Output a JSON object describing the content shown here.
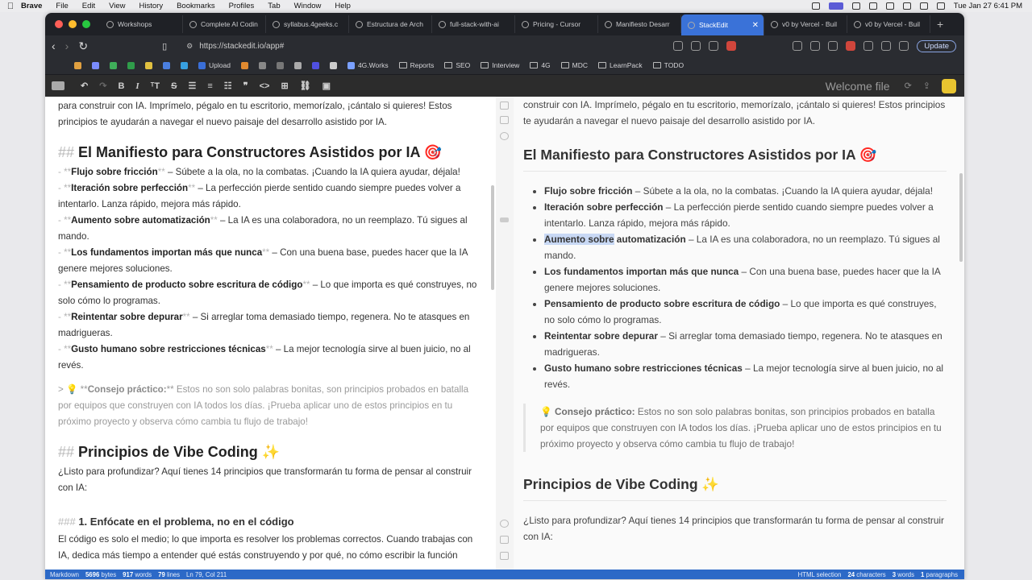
{
  "menubar": {
    "items": [
      "Brave",
      "File",
      "Edit",
      "View",
      "History",
      "Bookmarks",
      "Profiles",
      "Tab",
      "Window",
      "Help"
    ],
    "clock": "Tue Jan 27  6:41 PM"
  },
  "tabs": [
    {
      "label": "Workshops"
    },
    {
      "label": "Complete AI Codin"
    },
    {
      "label": "syllabus.4geeks.c"
    },
    {
      "label": "Estructura de Arch"
    },
    {
      "label": "full-stack-with-ai"
    },
    {
      "label": "Pricing - Cursor"
    },
    {
      "label": "Manifiesto Desarr"
    },
    {
      "label": "StackEdit",
      "active": true
    },
    {
      "label": "v0 by Vercel - Buil"
    },
    {
      "label": "v0 by Vercel - Buil"
    }
  ],
  "address": {
    "url": "https://stackedit.io/app#",
    "update_label": "Update"
  },
  "bookmarks": [
    "Upload",
    "4G.Works",
    "Reports",
    "SEO",
    "Interview",
    "4G",
    "MDC",
    "LearnPack",
    "TODO"
  ],
  "editor_toolbar": {
    "title": "Welcome file"
  },
  "editor": {
    "intro1": "para construir con IA. Imprímelo, pégalo en tu escritorio, memorízalo, ¡cántalo si quieres! Estos principios te ayudarán a navegar el nuevo paisaje del desarrollo asistido por IA.",
    "h2_mark": "##",
    "h2_1": "El Manifiesto para Constructores Asistidos por IA 🎯",
    "bullets": [
      {
        "bold": "Flujo sobre fricción",
        "text": " – Súbete a la ola, no la combatas. ¡Cuando la IA quiera ayudar, déjala!"
      },
      {
        "bold": "Iteración sobre perfección",
        "text": " – La perfección pierde sentido cuando siempre puedes volver a intentarlo. Lanza rápido, mejora más rápido."
      },
      {
        "bold": "Aumento sobre automatización",
        "text": " – La IA es una colaboradora, no un reemplazo. Tú sigues al mando."
      },
      {
        "bold": "Los fundamentos importan más que nunca",
        "text": " – Con una buena base, puedes hacer que la IA genere mejores soluciones."
      },
      {
        "bold": "Pensamiento de producto sobre escritura de código",
        "text": " – Lo que importa es qué construyes, no solo cómo lo programas."
      },
      {
        "bold": "Reintentar sobre depurar",
        "text": " – Si arreglar toma demasiado tiempo, regenera. No te atasques en madrigueras."
      },
      {
        "bold": "Gusto humano sobre restricciones técnicas",
        "text": " – La mejor tecnología sirve al buen juicio, no al revés."
      }
    ],
    "quote_bold": "Consejo práctico:",
    "quote_text": " Estos no son solo palabras bonitas, son principios probados en batalla por equipos que construyen con IA todos los días. ¡Prueba aplicar uno de estos principios en tu próximo proyecto y observa cómo cambia tu flujo de trabajo!",
    "h2_2": "Principios de Vibe Coding ✨",
    "p2": "¿Listo para profundizar? Aquí tienes 14 principios que transformarán tu forma de pensar al construir con IA:",
    "h3_mark": "###",
    "h3_1": "1. Enfócate en el problema, no en el código",
    "p3": "El código es solo el medio; lo que importa es resolver los problemas correctos. Cuando trabajas con IA, dedica más tiempo a entender qué estás construyendo y por qué, no cómo escribir la función"
  },
  "preview": {
    "intro1": "construir con IA. Imprímelo, pégalo en tu escritorio, memorízalo, ¡cántalo si quieres! Estos principios te ayudarán a navegar el nuevo paisaje del desarrollo asistido por IA.",
    "highlight": "Aumento sobre",
    "highlight_rest": " automatización",
    "p2": "¿Listo para profundizar? Aquí tienes 14 principios que transformarán tu forma de pensar al construir con IA:"
  },
  "status": {
    "left": [
      {
        "label": "Markdown"
      },
      {
        "label": "5696",
        "suffix": " bytes"
      },
      {
        "label": "917",
        "suffix": " words"
      },
      {
        "label": "79",
        "suffix": " lines"
      },
      {
        "label": "Ln 79, Col 211"
      }
    ],
    "right": [
      {
        "label": "HTML selection"
      },
      {
        "label": "24",
        "suffix": " characters"
      },
      {
        "label": "3",
        "suffix": " words"
      },
      {
        "label": "1",
        "suffix": " paragraphs"
      }
    ]
  }
}
